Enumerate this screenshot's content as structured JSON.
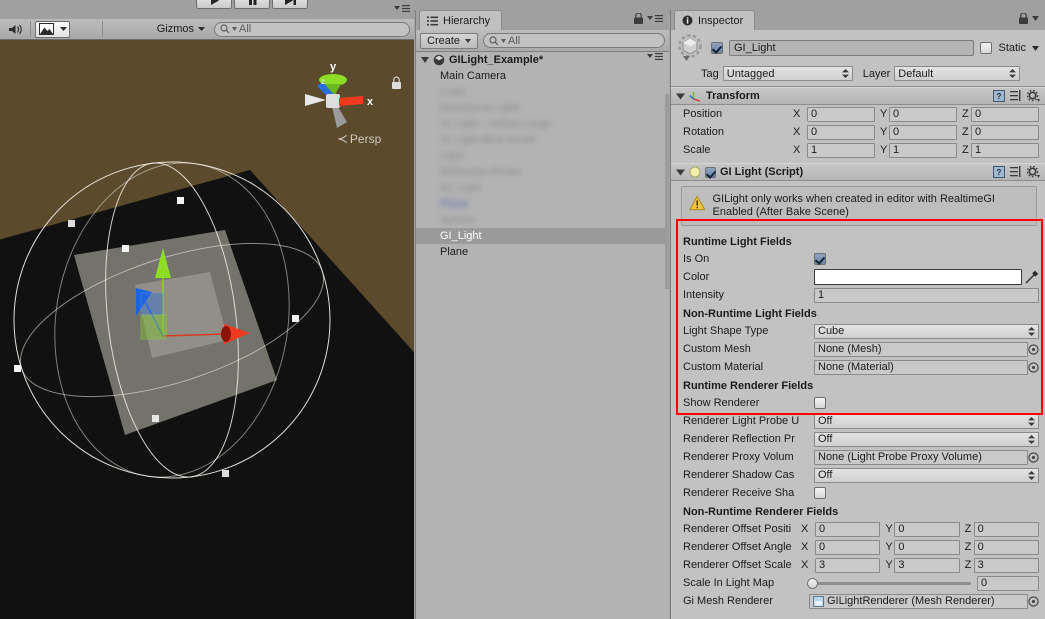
{
  "toolbar": {
    "play_label": "play-icon",
    "pause_label": "pause-icon",
    "step_label": "step-icon"
  },
  "scene": {
    "audio_icon": "audio-mute-icon",
    "effects_icon": "scene-effects-icon",
    "gizmos_label": "Gizmos",
    "search_value": "All",
    "search_placeholder": "All",
    "gizmo": {
      "axis_y": "y",
      "axis_x": "x",
      "projection_label": "Persp"
    }
  },
  "hierarchy": {
    "tab_label": "Hierarchy",
    "create_label": "Create",
    "search_value": "All",
    "search_placeholder": "All",
    "items": [
      {
        "label": "GILight_Example*",
        "type": "scene",
        "blurred": false,
        "selected": false
      },
      {
        "label": "Main Camera",
        "type": "object",
        "blurred": false,
        "selected": false
      },
      {
        "label": "Cube",
        "type": "object",
        "blurred": true,
        "selected": false
      },
      {
        "label": "Directional Light",
        "type": "object",
        "blurred": true,
        "selected": false
      },
      {
        "label": "GI Light - Yellow Large",
        "type": "object",
        "blurred": true,
        "selected": false
      },
      {
        "label": "GI Light Blue Small",
        "type": "object",
        "blurred": true,
        "selected": false
      },
      {
        "label": "Light",
        "type": "object",
        "blurred": true,
        "selected": false
      },
      {
        "label": "Reflection Probe",
        "type": "object",
        "blurred": true,
        "selected": false
      },
      {
        "label": "GI_Light",
        "type": "object",
        "blurred": true,
        "selected": false
      },
      {
        "label": "Plane",
        "type": "object",
        "blurred": true,
        "selected": false,
        "link": true
      },
      {
        "label": "Sphere",
        "type": "object",
        "blurred": true,
        "selected": false
      },
      {
        "label": "GI_Light",
        "type": "object",
        "blurred": false,
        "selected": true
      },
      {
        "label": "Plane",
        "type": "object",
        "blurred": false,
        "selected": false
      }
    ]
  },
  "inspector": {
    "tab_label": "Inspector",
    "identity": {
      "enabled": true,
      "name": "GI_Light",
      "static_label": "Static",
      "static_checked": false,
      "tag_label": "Tag",
      "tag_value": "Untagged",
      "layer_label": "Layer",
      "layer_value": "Default"
    },
    "transform": {
      "title": "Transform",
      "rows": [
        {
          "label": "Position",
          "x": "0",
          "y": "0",
          "z": "0"
        },
        {
          "label": "Rotation",
          "x": "0",
          "y": "0",
          "z": "0"
        },
        {
          "label": "Scale",
          "x": "1",
          "y": "1",
          "z": "1"
        }
      ]
    },
    "gilight": {
      "title": "GI Light (Script)",
      "enabled": true,
      "warning": "GILight only works when created in editor with RealtimeGI Enabled (After Bake Scene)",
      "runtime_light_fields": {
        "title": "Runtime Light Fields",
        "is_on_label": "Is On",
        "is_on": true,
        "color_label": "Color",
        "color_value": "#ffffff",
        "intensity_label": "Intensity",
        "intensity_value": "1"
      },
      "non_runtime_light_fields": {
        "title": "Non-Runtime Light Fields",
        "light_shape_type_label": "Light Shape Type",
        "light_shape_type_value": "Cube",
        "custom_mesh_label": "Custom Mesh",
        "custom_mesh_value": "None (Mesh)",
        "custom_material_label": "Custom Material",
        "custom_material_value": "None (Material)"
      },
      "runtime_renderer_fields": {
        "title": "Runtime Renderer Fields",
        "show_renderer_label": "Show Renderer",
        "show_renderer": false,
        "light_probe_label": "Renderer Light Probe U",
        "light_probe_value": "Off",
        "reflection_probe_label": "Renderer Reflection Pr",
        "reflection_probe_value": "Off",
        "proxy_volume_label": "Renderer Proxy Volum",
        "proxy_volume_value": "None (Light Probe Proxy Volume)",
        "shadow_cast_label": "Renderer Shadow Cas",
        "shadow_cast_value": "Off",
        "receive_shadows_label": "Renderer Receive Sha",
        "receive_shadows": false
      },
      "non_runtime_renderer_fields": {
        "title": "Non-Runtime Renderer Fields",
        "offset_position_label": "Renderer Offset Positi",
        "offset_position": {
          "x": "0",
          "y": "0",
          "z": "0"
        },
        "offset_angle_label": "Renderer Offset Angle",
        "offset_angle": {
          "x": "0",
          "y": "0",
          "z": "0"
        },
        "offset_scale_label": "Renderer Offset Scale",
        "offset_scale": {
          "x": "3",
          "y": "3",
          "z": "3"
        },
        "scale_in_light_map_label": "Scale In Light Map",
        "scale_in_light_map_value": "0",
        "gi_mesh_renderer_label": "Gi Mesh Renderer",
        "gi_mesh_renderer_value": "GILightRenderer (Mesh Renderer)"
      }
    },
    "axis_x": "X",
    "axis_y": "Y",
    "axis_z": "Z"
  },
  "colors": {
    "highlight_box": "#ff0000",
    "scene_background": "#5b4a2b",
    "panel_background": "#c2c2c2",
    "selection": "#9a9a9a"
  }
}
